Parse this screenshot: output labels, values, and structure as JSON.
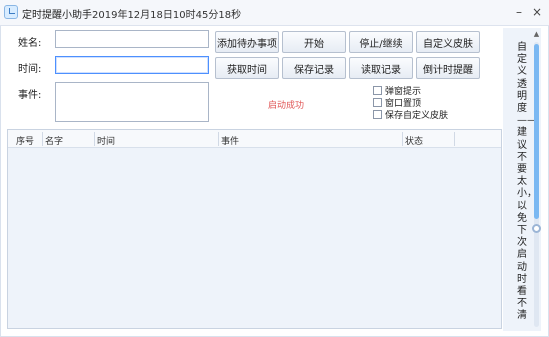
{
  "window": {
    "title": "定时提醒小助手",
    "current_time": "2019年12月18日10时45分18秒",
    "minimize_glyph": "–",
    "close_glyph": "×"
  },
  "form": {
    "name_label": "姓名:",
    "time_label": "时间:",
    "event_label": "事件:",
    "name_value": "",
    "time_value": "",
    "event_value": ""
  },
  "buttons": {
    "add_todo": "添加待办事项",
    "start": "开始",
    "pause_resume": "停止/继续",
    "custom_skin": "自定义皮肤",
    "get_time": "获取时间",
    "save_records": "保存记录",
    "read_records": "读取记录",
    "countdown_reminder": "倒计时提醒"
  },
  "status": {
    "message": "启动成功",
    "color": "#e05555"
  },
  "options": [
    {
      "label": "弹窗提示",
      "checked": false
    },
    {
      "label": "窗口置顶",
      "checked": false
    },
    {
      "label": "保存自定义皮肤",
      "checked": false
    }
  ],
  "table": {
    "columns": [
      "序号",
      "名字",
      "时间",
      "事件",
      "状态"
    ],
    "rows": []
  },
  "side_panel": {
    "transparency_note": "自定义透明度——建议不要太小，以免下次启动时看不清"
  },
  "theme": {
    "accent": "#4d90fe",
    "scroll_thumb": "#7ab8f2",
    "table_background": "#eef3fa"
  }
}
